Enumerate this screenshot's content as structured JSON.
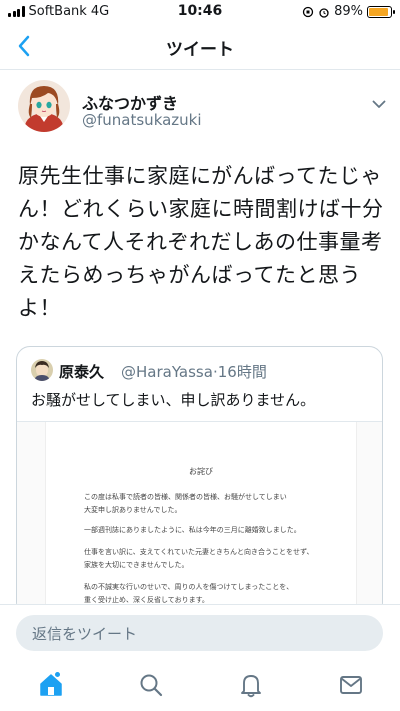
{
  "status_bar": {
    "carrier": "SoftBank",
    "network": "4G",
    "time": "10:46",
    "battery_percent": "89%",
    "battery_level": 0.89,
    "battery_color": "#f5a623"
  },
  "header": {
    "title": "ツイート",
    "back_icon": "chevron-left-icon",
    "accent_color": "#1da1f2"
  },
  "tweet": {
    "display_name": "ふなつかずき",
    "handle": "@funatsukazuki",
    "text": "原先生仕事に家庭にがんばってたじゃん！どれくらい家庭に時間割けば十分かなんて人それぞれだしあの仕事量考えたらめっちゃがんばってたと思うよ！",
    "menu_icon": "chevron-down-icon"
  },
  "quoted_tweet": {
    "display_name": "原泰久",
    "handle": "@HaraYassa",
    "time": "16時間",
    "separator": "·",
    "text": "お騒がせしてしまい、申し訳ありません。",
    "image": {
      "title": "お詫び",
      "lines": [
        "この度は私事で読者の皆様、関係者の皆様、お騒がせしてしまい",
        "大変申し訳ありませんでした。",
        "一部週刊誌にありましたように、私は今年の三月に離婚致しました。",
        "仕事を言い訳に、支えてくれていた元妻ときちんと向き合うことをせず、",
        "家族を大切にできませんでした。",
        "私の不誠実な行いのせいで、周りの人を傷つけてしまったことを、",
        "重く受け止め、深く反省しております。"
      ]
    }
  },
  "reply": {
    "placeholder": "返信をツイート"
  },
  "tab_bar": {
    "items": [
      {
        "name": "home",
        "icon": "home-icon"
      },
      {
        "name": "search",
        "icon": "search-icon"
      },
      {
        "name": "notifications",
        "icon": "bell-icon"
      },
      {
        "name": "messages",
        "icon": "mail-icon"
      }
    ]
  }
}
